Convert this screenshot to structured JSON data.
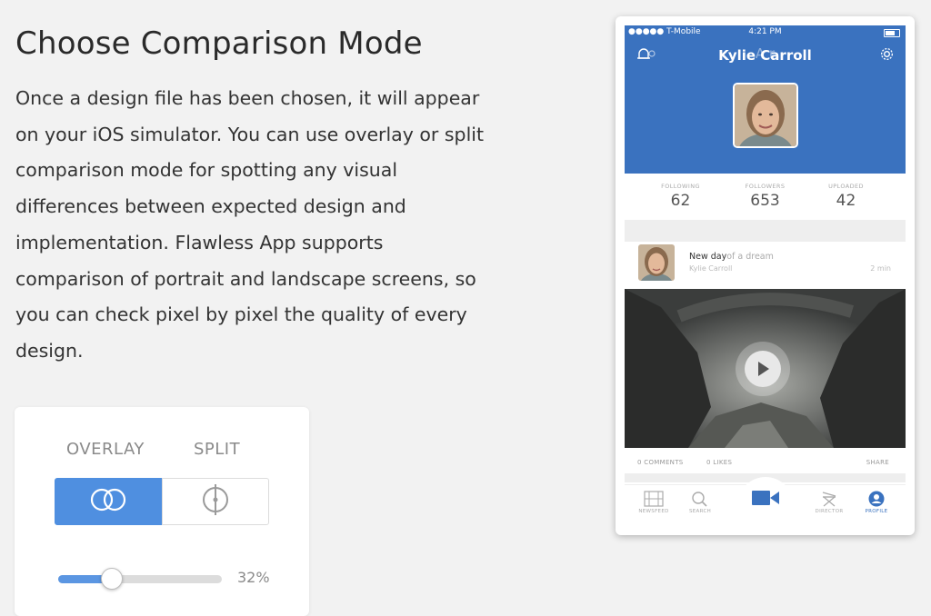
{
  "heading": "Choose Comparison Mode",
  "paragraph_lines": [
    "Once a design file has been chosen, it will appear",
    "on your iOS simulator. You can use overlay or split",
    "comparison mode for spotting any visual",
    "differences between expected design and",
    "implementation. Flawless App supports",
    "comparison of portrait and landscape screens, so",
    "you can check pixel by pixel the quality of every",
    "design."
  ],
  "controls": {
    "overlay_label": "OVERLAY",
    "split_label": "SPLIT",
    "active_mode": "overlay",
    "slider_percent": 32,
    "slider_label": "32%",
    "accent_color": "#4f8fe0",
    "overlay_icon": "overlay-circles-icon",
    "split_icon": "split-crosshair-icon"
  },
  "phone": {
    "status": {
      "carrier": "●●●●● T-Mobile",
      "time": "4:21 PM"
    },
    "ghost_title": "A                    r",
    "profile_name": "Kylie Carroll",
    "header_color": "#3a72bf",
    "stats": [
      {
        "label": "FOLLOWING",
        "value": "62"
      },
      {
        "label": "FOLLOWERS",
        "value": "653"
      },
      {
        "label": "UPLOADED",
        "value": "42"
      }
    ],
    "post": {
      "title": "New day",
      "title_faded": "of a dream",
      "author": "Kylie Carroll",
      "time": "2 min"
    },
    "actions": {
      "comments": "0 COMMENTS",
      "likes": "0 LIKES",
      "share": "SHARE"
    },
    "tabs": [
      {
        "label": "NEWSFEED",
        "icon": "film-icon"
      },
      {
        "label": "SEARCH",
        "icon": "search-icon"
      },
      {
        "label": "",
        "icon": "video-camera-icon"
      },
      {
        "label": "DIRECTOR",
        "icon": "director-chair-icon"
      },
      {
        "label": "PROFILE",
        "icon": "profile-icon"
      }
    ]
  }
}
